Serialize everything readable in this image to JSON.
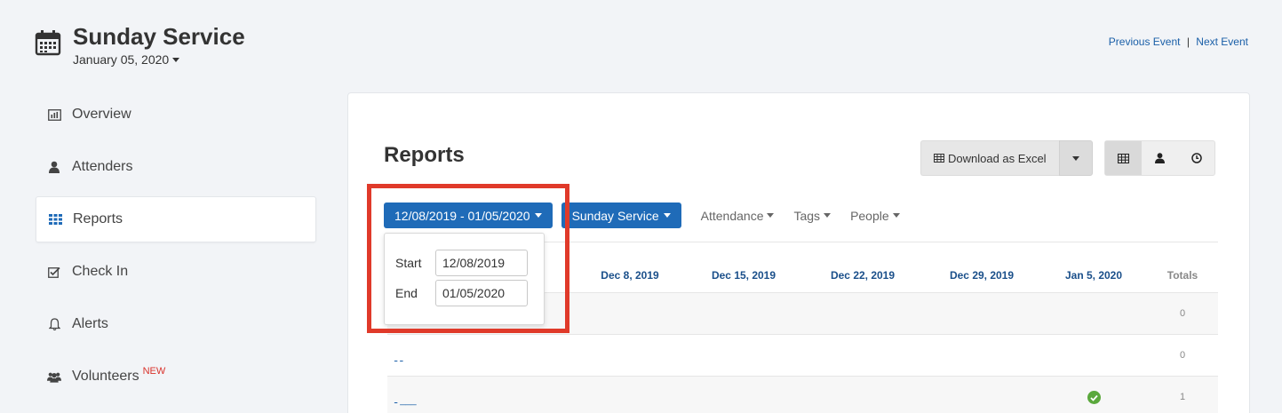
{
  "header": {
    "title": "Sunday Service",
    "date": "January 05, 2020",
    "previous_event": "Previous Event",
    "separator": "|",
    "next_event": "Next Event"
  },
  "sidebar": {
    "items": [
      {
        "label": "Overview",
        "icon": "bar-chart-icon"
      },
      {
        "label": "Attenders",
        "icon": "person-icon"
      },
      {
        "label": "Reports",
        "icon": "grid-icon",
        "active": true
      },
      {
        "label": "Check In",
        "icon": "checkbox-icon"
      },
      {
        "label": "Alerts",
        "icon": "bell-icon"
      },
      {
        "label": "Volunteers",
        "icon": "group-icon",
        "badge": "NEW"
      }
    ]
  },
  "main": {
    "title": "Reports",
    "download_label": "Download as Excel",
    "filters": {
      "date_range": "12/08/2019 - 01/05/2020",
      "event": "Sunday Service",
      "attendance": "Attendance",
      "tags": "Tags",
      "people": "People"
    },
    "date_dropdown": {
      "start_label": "Start",
      "start_value": "12/08/2019",
      "end_label": "End",
      "end_value": "01/05/2020"
    },
    "table": {
      "columns": [
        "Dec 8, 2019",
        "Dec 15, 2019",
        "Dec 22, 2019",
        "Dec 29, 2019",
        "Jan 5, 2020",
        "Totals"
      ],
      "rows": [
        {
          "name": "",
          "total": "0"
        },
        {
          "name": "ـ ـ",
          "total": "0"
        },
        {
          "name": "ـ ___",
          "total": "1",
          "checked_column": "Jan 5, 2020"
        }
      ]
    }
  },
  "colors": {
    "accent": "#1f6bb8",
    "highlight": "#e03a2a",
    "check": "#5aa83c"
  }
}
